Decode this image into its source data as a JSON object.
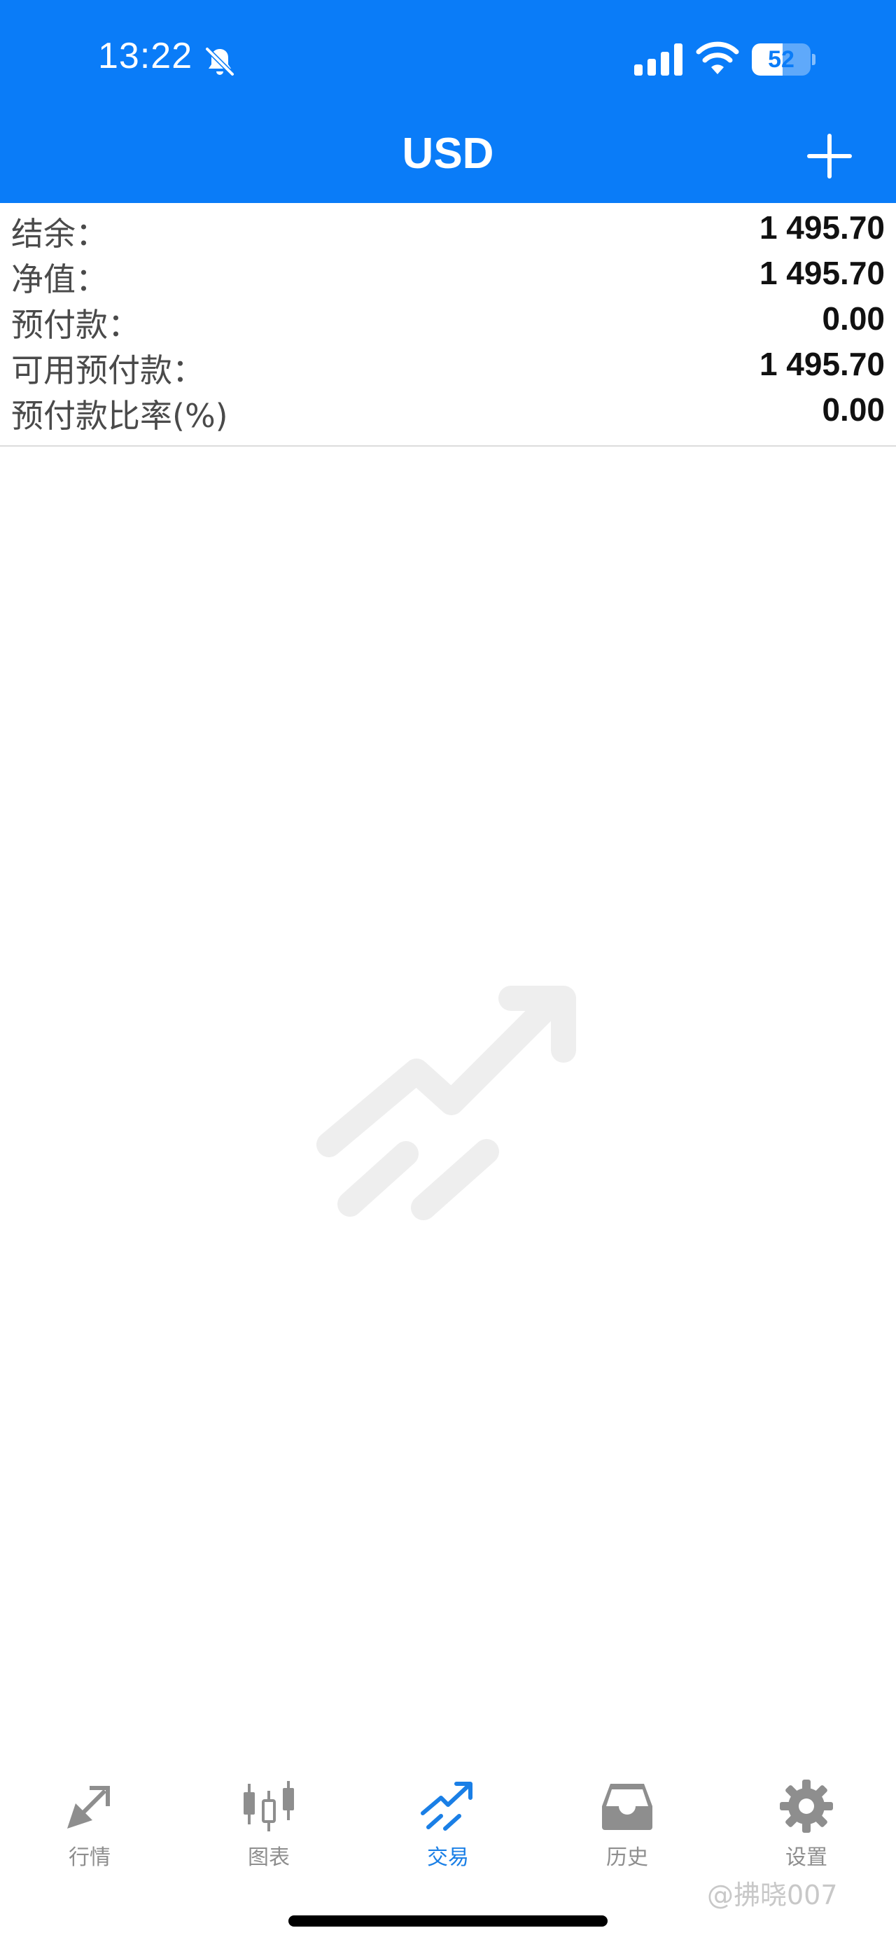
{
  "status_bar": {
    "time": "13:22",
    "battery_level": "52",
    "icons": [
      "bell-off-icon",
      "cellular-signal-icon",
      "wifi-icon",
      "battery-icon"
    ]
  },
  "header": {
    "title": "USD",
    "add_icon": "plus-icon"
  },
  "account_summary": [
    {
      "label": "结余：",
      "value": "1 495.70"
    },
    {
      "label": "净值：",
      "value": "1 495.70"
    },
    {
      "label": "预付款：",
      "value": "0.00"
    },
    {
      "label": "可用预付款：",
      "value": "1 495.70"
    },
    {
      "label": "预付款比率(%)",
      "value": "0.00"
    }
  ],
  "empty_state": {
    "icon": "trading-chart-icon"
  },
  "tab_bar": {
    "tabs": [
      {
        "label": "行情",
        "icon": "quotes-arrows-icon",
        "active": false
      },
      {
        "label": "图表",
        "icon": "candlestick-icon",
        "active": false
      },
      {
        "label": "交易",
        "icon": "trade-icon",
        "active": true
      },
      {
        "label": "历史",
        "icon": "history-inbox-icon",
        "active": false
      },
      {
        "label": "设置",
        "icon": "gear-icon",
        "active": false
      }
    ]
  },
  "watermark": "@拂晓007",
  "colors": {
    "header_blue": "#0a7cf8",
    "active_tab": "#1a7fe6",
    "inactive_tab": "#8e8e8e"
  }
}
